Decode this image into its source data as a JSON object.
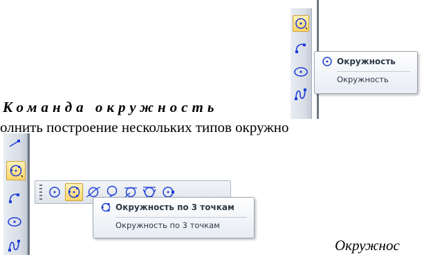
{
  "document": {
    "heading": "Команда окружность",
    "body_line": "олнить построение нескольких типов окружно",
    "caption_italic": "Окружнос"
  },
  "tooltip_top": {
    "title": "Окружность",
    "subtitle": "Окружность"
  },
  "tooltip_bottom": {
    "title": "Окружность по 3 точкам",
    "subtitle": "Окружность по 3 точкам"
  },
  "toolbar_top": {
    "tools": [
      "circle-center-icon",
      "arc-icon",
      "ellipse-icon",
      "bezier-icon"
    ]
  },
  "toolbar_bottom": {
    "tools": [
      "line-icon",
      "circle-3points-icon",
      "arc-icon",
      "ellipse-icon",
      "bezier-icon"
    ]
  },
  "circle_subtoolbar": {
    "tools": [
      "circle-center-icon",
      "circle-3points-icon",
      "circle-tangent-curve-icon",
      "circle-tangent-icon",
      "circle-tangent-2-curves-icon",
      "circle-tangent-3-curves-icon",
      "circle-center-point-icon"
    ]
  },
  "colors": {
    "icon_blue": "#1f3fd6",
    "highlight": "#ffd56a"
  }
}
